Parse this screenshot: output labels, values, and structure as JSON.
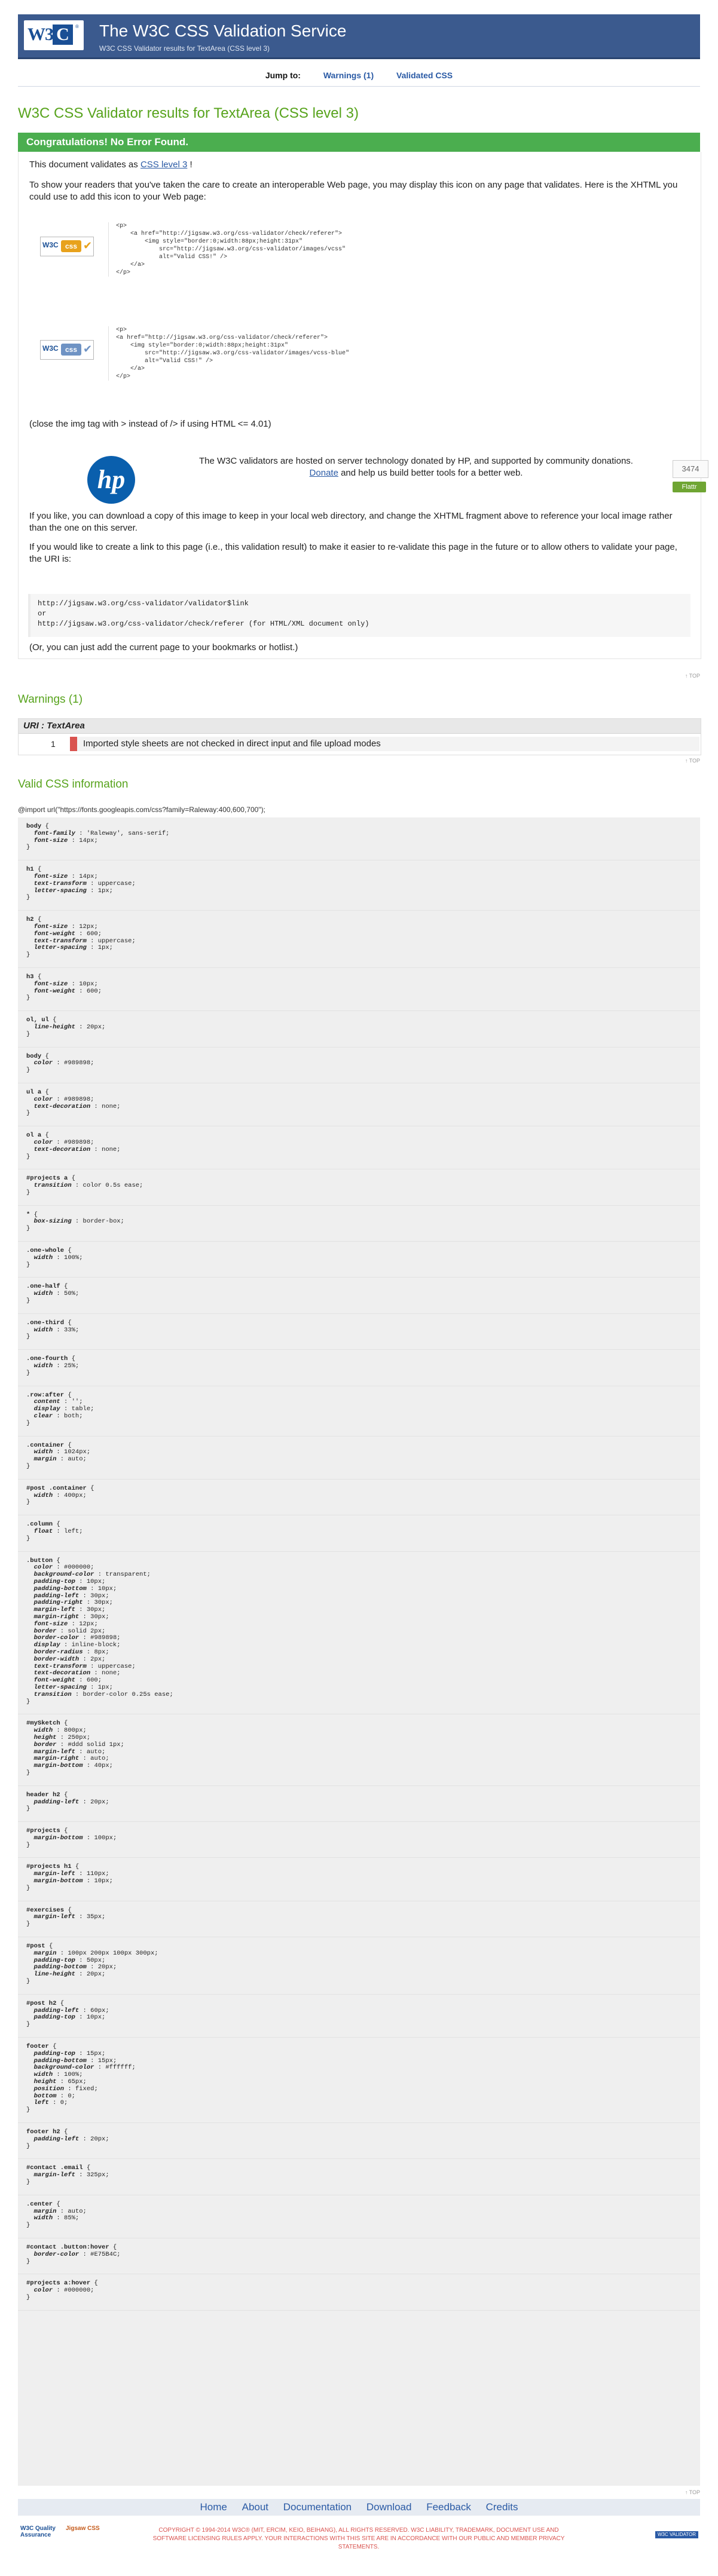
{
  "header": {
    "logo_text": "W3C",
    "title": "The W3C CSS Validation Service",
    "subtitle": "W3C CSS Validator results for TextArea (CSS level 3)"
  },
  "jump": {
    "label": "Jump to:",
    "links": [
      "Warnings (1)",
      "Validated CSS"
    ]
  },
  "page_title": "W3C CSS Validator results for TextArea (CSS level 3)",
  "congrats": "Congratulations! No Error Found.",
  "validates": {
    "prefix": "This document validates as ",
    "link": "CSS level 3",
    "suffix": " !"
  },
  "badge_intro": "To show your readers that you've taken the care to create an interoperable Web page, you may display this icon on any page that validates. Here is the XHTML you could use to add this icon to your Web page:",
  "badge1": {
    "alt": "Valid CSS!",
    "code": "<p>\n    <a href=\"http://jigsaw.w3.org/css-validator/check/referer\">\n        <img style=\"border:0;width:88px;height:31px\"\n            src=\"http://jigsaw.w3.org/css-validator/images/vcss\"\n            alt=\"Valid CSS!\" />\n    </a>\n</p>"
  },
  "badge2": {
    "alt": "Valid CSS!",
    "code": "<p>\n<a href=\"http://jigsaw.w3.org/css-validator/check/referer\">\n    <img style=\"border:0;width:88px;height:31px\"\n        src=\"http://jigsaw.w3.org/css-validator/images/vcss-blue\"\n        alt=\"Valid CSS!\" />\n    </a>\n</p>"
  },
  "close_tag_note": "(close the img tag with > instead of /> if using HTML <= 4.01)",
  "sponsor": {
    "logo_text": "hp",
    "text_before": "The W3C validators are hosted on server technology donated by HP, and supported by community donations.",
    "donate_link": "Donate",
    "text_after": " and help us build better tools for a better web.",
    "counter": "3474",
    "flattr_label": "Flattr"
  },
  "download_note": "If you like, you can download a copy of this image to keep in your local web directory, and change the XHTML fragment above to reference your local image rather than the one on this server.",
  "link_note": "If you would like to create a link to this page (i.e., this validation result) to make it easier to re-validate this page in the future or to allow others to validate your page, the URI is:",
  "uri_block": "http://jigsaw.w3.org/css-validator/validator$link\nor\nhttp://jigsaw.w3.org/css-validator/check/referer (for HTML/XML document only)",
  "bookmark_note": "(Or, you can just add the current page to your bookmarks or hotlist.)",
  "top_label": "↑ TOP",
  "warnings": {
    "heading": "Warnings (1)",
    "uri_label": "URI : TextArea",
    "items": [
      {
        "line": "1",
        "message": "Imported style sheets are not checked in direct input and file upload modes"
      }
    ]
  },
  "valid_css": {
    "heading": "Valid CSS information",
    "import_line": "@import url(\"https://fonts.googleapis.com/css?family=Raleway:400,600,700\");",
    "rules": [
      {
        "selector": "body",
        "decls": [
          [
            "font-family",
            "'Raleway', sans-serif"
          ],
          [
            "font-size",
            "14px"
          ]
        ]
      },
      {
        "selector": "h1",
        "decls": [
          [
            "font-size",
            "14px"
          ],
          [
            "text-transform",
            "uppercase"
          ],
          [
            "letter-spacing",
            "1px"
          ]
        ]
      },
      {
        "selector": "h2",
        "decls": [
          [
            "font-size",
            "12px"
          ],
          [
            "font-weight",
            "600"
          ],
          [
            "text-transform",
            "uppercase"
          ],
          [
            "letter-spacing",
            "1px"
          ]
        ]
      },
      {
        "selector": "h3",
        "decls": [
          [
            "font-size",
            "10px"
          ],
          [
            "font-weight",
            "600"
          ]
        ]
      },
      {
        "selector": "ol, ul",
        "decls": [
          [
            "line-height",
            "20px"
          ]
        ]
      },
      {
        "selector": "body",
        "decls": [
          [
            "color",
            "#989898"
          ]
        ]
      },
      {
        "selector": "ul a",
        "decls": [
          [
            "color",
            "#989898"
          ],
          [
            "text-decoration",
            "none"
          ]
        ]
      },
      {
        "selector": "ol a",
        "decls": [
          [
            "color",
            "#989898"
          ],
          [
            "text-decoration",
            "none"
          ]
        ]
      },
      {
        "selector": "#projects a",
        "decls": [
          [
            "transition",
            "color 0.5s ease"
          ]
        ]
      },
      {
        "selector": "*",
        "decls": [
          [
            "box-sizing",
            "border-box"
          ]
        ]
      },
      {
        "selector": ".one-whole",
        "decls": [
          [
            "width",
            "100%"
          ]
        ]
      },
      {
        "selector": ".one-half",
        "decls": [
          [
            "width",
            "50%"
          ]
        ]
      },
      {
        "selector": ".one-third",
        "decls": [
          [
            "width",
            "33%"
          ]
        ]
      },
      {
        "selector": ".one-fourth",
        "decls": [
          [
            "width",
            "25%"
          ]
        ]
      },
      {
        "selector": ".row:after",
        "decls": [
          [
            "content",
            "''"
          ],
          [
            "display",
            "table"
          ],
          [
            "clear",
            "both"
          ]
        ]
      },
      {
        "selector": ".container",
        "decls": [
          [
            "width",
            "1024px"
          ],
          [
            "margin",
            "auto"
          ]
        ]
      },
      {
        "selector": "#post .container",
        "decls": [
          [
            "width",
            "400px"
          ]
        ]
      },
      {
        "selector": ".column",
        "decls": [
          [
            "float",
            "left"
          ]
        ]
      },
      {
        "selector": ".button",
        "decls": [
          [
            "color",
            "#000000"
          ],
          [
            "background-color",
            "transparent"
          ],
          [
            "padding-top",
            "10px"
          ],
          [
            "padding-bottom",
            "10px"
          ],
          [
            "padding-left",
            "30px"
          ],
          [
            "padding-right",
            "30px"
          ],
          [
            "margin-left",
            "30px"
          ],
          [
            "margin-right",
            "30px"
          ],
          [
            "font-size",
            "12px"
          ],
          [
            "border",
            "solid 2px"
          ],
          [
            "border-color",
            "#989898"
          ],
          [
            "display",
            "inline-block"
          ],
          [
            "border-radius",
            "8px"
          ],
          [
            "border-width",
            "2px"
          ],
          [
            "text-transform",
            "uppercase"
          ],
          [
            "text-decoration",
            "none"
          ],
          [
            "font-weight",
            "600"
          ],
          [
            "letter-spacing",
            "1px"
          ],
          [
            "transition",
            "border-color 0.25s ease"
          ]
        ]
      },
      {
        "selector": "#mySketch",
        "decls": [
          [
            "width",
            "800px"
          ],
          [
            "height",
            "250px"
          ],
          [
            "border",
            "#ddd solid 1px"
          ],
          [
            "margin-left",
            "auto"
          ],
          [
            "margin-right",
            "auto"
          ],
          [
            "margin-bottom",
            "40px"
          ]
        ]
      },
      {
        "selector": "header h2",
        "decls": [
          [
            "padding-left",
            "20px"
          ]
        ]
      },
      {
        "selector": "#projects",
        "decls": [
          [
            "margin-bottom",
            "100px"
          ]
        ]
      },
      {
        "selector": "#projects h1",
        "decls": [
          [
            "margin-left",
            "110px"
          ],
          [
            "margin-bottom",
            "10px"
          ]
        ]
      },
      {
        "selector": "#exercises",
        "decls": [
          [
            "margin-left",
            "35px"
          ]
        ]
      },
      {
        "selector": "#post",
        "decls": [
          [
            "margin",
            "100px 200px 100px 300px"
          ],
          [
            "padding-top",
            "50px"
          ],
          [
            "padding-bottom",
            "20px"
          ],
          [
            "line-height",
            "20px"
          ]
        ]
      },
      {
        "selector": "#post h2",
        "decls": [
          [
            "padding-left",
            "60px"
          ],
          [
            "padding-top",
            "10px"
          ]
        ]
      },
      {
        "selector": "footer",
        "decls": [
          [
            "padding-top",
            "15px"
          ],
          [
            "padding-bottom",
            "15px"
          ],
          [
            "background-color",
            "#ffffff"
          ],
          [
            "width",
            "100%"
          ],
          [
            "height",
            "65px"
          ],
          [
            "position",
            "fixed"
          ],
          [
            "bottom",
            "0"
          ],
          [
            "left",
            "0"
          ]
        ]
      },
      {
        "selector": "footer h2",
        "decls": [
          [
            "padding-left",
            "20px"
          ]
        ]
      },
      {
        "selector": "#contact .email",
        "decls": [
          [
            "margin-left",
            "325px"
          ]
        ]
      },
      {
        "selector": ".center",
        "decls": [
          [
            "margin",
            "auto"
          ],
          [
            "width",
            "85%"
          ]
        ]
      },
      {
        "selector": "#contact .button:hover",
        "decls": [
          [
            "border-color",
            "#E75B4C"
          ]
        ]
      },
      {
        "selector": "#projects a:hover",
        "decls": [
          [
            "color",
            "#000000"
          ]
        ]
      }
    ]
  },
  "footer": {
    "links": [
      "Home",
      "About",
      "Documentation",
      "Download",
      "Feedback",
      "Credits"
    ],
    "logo_left": "W3C Quality Assurance",
    "logo_mid": "Jigsaw CSS",
    "copyright": "COPYRIGHT © 1994-2014 W3C® (MIT, ERCIM, KEIO, BEIHANG), ALL RIGHTS RESERVED. W3C LIABILITY, TRADEMARK, DOCUMENT USE AND SOFTWARE LICENSING RULES APPLY. YOUR INTERACTIONS WITH THIS SITE ARE IN ACCORDANCE WITH OUR PUBLIC AND MEMBER PRIVACY STATEMENTS.",
    "badge": "W3C VALIDATOR"
  },
  "colors": {
    "header_bg": "#3b5a8e",
    "success_green": "#4bae4f",
    "heading_green": "#57a31c",
    "warning_red": "#d9534f",
    "link_blue": "#2a5aa5"
  }
}
